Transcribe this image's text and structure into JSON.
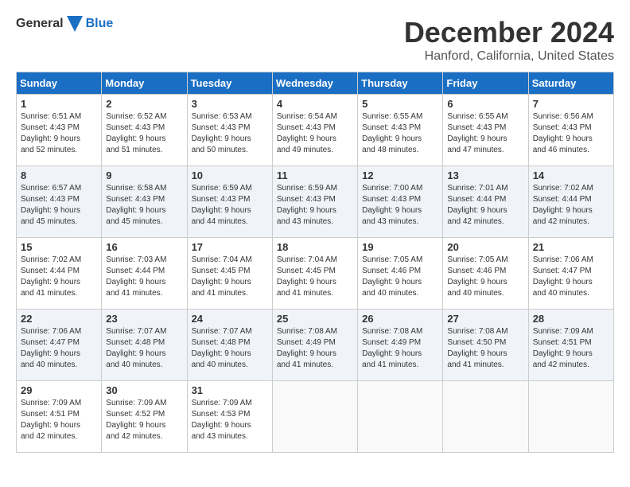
{
  "logo": {
    "general": "General",
    "blue": "Blue"
  },
  "title": "December 2024",
  "subtitle": "Hanford, California, United States",
  "headers": [
    "Sunday",
    "Monday",
    "Tuesday",
    "Wednesday",
    "Thursday",
    "Friday",
    "Saturday"
  ],
  "weeks": [
    [
      {
        "day": "1",
        "sunrise": "6:51 AM",
        "sunset": "4:43 PM",
        "daylight": "9 hours and 52 minutes."
      },
      {
        "day": "2",
        "sunrise": "6:52 AM",
        "sunset": "4:43 PM",
        "daylight": "9 hours and 51 minutes."
      },
      {
        "day": "3",
        "sunrise": "6:53 AM",
        "sunset": "4:43 PM",
        "daylight": "9 hours and 50 minutes."
      },
      {
        "day": "4",
        "sunrise": "6:54 AM",
        "sunset": "4:43 PM",
        "daylight": "9 hours and 49 minutes."
      },
      {
        "day": "5",
        "sunrise": "6:55 AM",
        "sunset": "4:43 PM",
        "daylight": "9 hours and 48 minutes."
      },
      {
        "day": "6",
        "sunrise": "6:55 AM",
        "sunset": "4:43 PM",
        "daylight": "9 hours and 47 minutes."
      },
      {
        "day": "7",
        "sunrise": "6:56 AM",
        "sunset": "4:43 PM",
        "daylight": "9 hours and 46 minutes."
      }
    ],
    [
      {
        "day": "8",
        "sunrise": "6:57 AM",
        "sunset": "4:43 PM",
        "daylight": "9 hours and 45 minutes."
      },
      {
        "day": "9",
        "sunrise": "6:58 AM",
        "sunset": "4:43 PM",
        "daylight": "9 hours and 45 minutes."
      },
      {
        "day": "10",
        "sunrise": "6:59 AM",
        "sunset": "4:43 PM",
        "daylight": "9 hours and 44 minutes."
      },
      {
        "day": "11",
        "sunrise": "6:59 AM",
        "sunset": "4:43 PM",
        "daylight": "9 hours and 43 minutes."
      },
      {
        "day": "12",
        "sunrise": "7:00 AM",
        "sunset": "4:43 PM",
        "daylight": "9 hours and 43 minutes."
      },
      {
        "day": "13",
        "sunrise": "7:01 AM",
        "sunset": "4:44 PM",
        "daylight": "9 hours and 42 minutes."
      },
      {
        "day": "14",
        "sunrise": "7:02 AM",
        "sunset": "4:44 PM",
        "daylight": "9 hours and 42 minutes."
      }
    ],
    [
      {
        "day": "15",
        "sunrise": "7:02 AM",
        "sunset": "4:44 PM",
        "daylight": "9 hours and 41 minutes."
      },
      {
        "day": "16",
        "sunrise": "7:03 AM",
        "sunset": "4:44 PM",
        "daylight": "9 hours and 41 minutes."
      },
      {
        "day": "17",
        "sunrise": "7:04 AM",
        "sunset": "4:45 PM",
        "daylight": "9 hours and 41 minutes."
      },
      {
        "day": "18",
        "sunrise": "7:04 AM",
        "sunset": "4:45 PM",
        "daylight": "9 hours and 41 minutes."
      },
      {
        "day": "19",
        "sunrise": "7:05 AM",
        "sunset": "4:46 PM",
        "daylight": "9 hours and 40 minutes."
      },
      {
        "day": "20",
        "sunrise": "7:05 AM",
        "sunset": "4:46 PM",
        "daylight": "9 hours and 40 minutes."
      },
      {
        "day": "21",
        "sunrise": "7:06 AM",
        "sunset": "4:47 PM",
        "daylight": "9 hours and 40 minutes."
      }
    ],
    [
      {
        "day": "22",
        "sunrise": "7:06 AM",
        "sunset": "4:47 PM",
        "daylight": "9 hours and 40 minutes."
      },
      {
        "day": "23",
        "sunrise": "7:07 AM",
        "sunset": "4:48 PM",
        "daylight": "9 hours and 40 minutes."
      },
      {
        "day": "24",
        "sunrise": "7:07 AM",
        "sunset": "4:48 PM",
        "daylight": "9 hours and 40 minutes."
      },
      {
        "day": "25",
        "sunrise": "7:08 AM",
        "sunset": "4:49 PM",
        "daylight": "9 hours and 41 minutes."
      },
      {
        "day": "26",
        "sunrise": "7:08 AM",
        "sunset": "4:49 PM",
        "daylight": "9 hours and 41 minutes."
      },
      {
        "day": "27",
        "sunrise": "7:08 AM",
        "sunset": "4:50 PM",
        "daylight": "9 hours and 41 minutes."
      },
      {
        "day": "28",
        "sunrise": "7:09 AM",
        "sunset": "4:51 PM",
        "daylight": "9 hours and 42 minutes."
      }
    ],
    [
      {
        "day": "29",
        "sunrise": "7:09 AM",
        "sunset": "4:51 PM",
        "daylight": "9 hours and 42 minutes."
      },
      {
        "day": "30",
        "sunrise": "7:09 AM",
        "sunset": "4:52 PM",
        "daylight": "9 hours and 42 minutes."
      },
      {
        "day": "31",
        "sunrise": "7:09 AM",
        "sunset": "4:53 PM",
        "daylight": "9 hours and 43 minutes."
      },
      null,
      null,
      null,
      null
    ]
  ],
  "labels": {
    "sunrise_prefix": "Sunrise: ",
    "sunset_prefix": "Sunset: ",
    "daylight_prefix": "Daylight: "
  }
}
